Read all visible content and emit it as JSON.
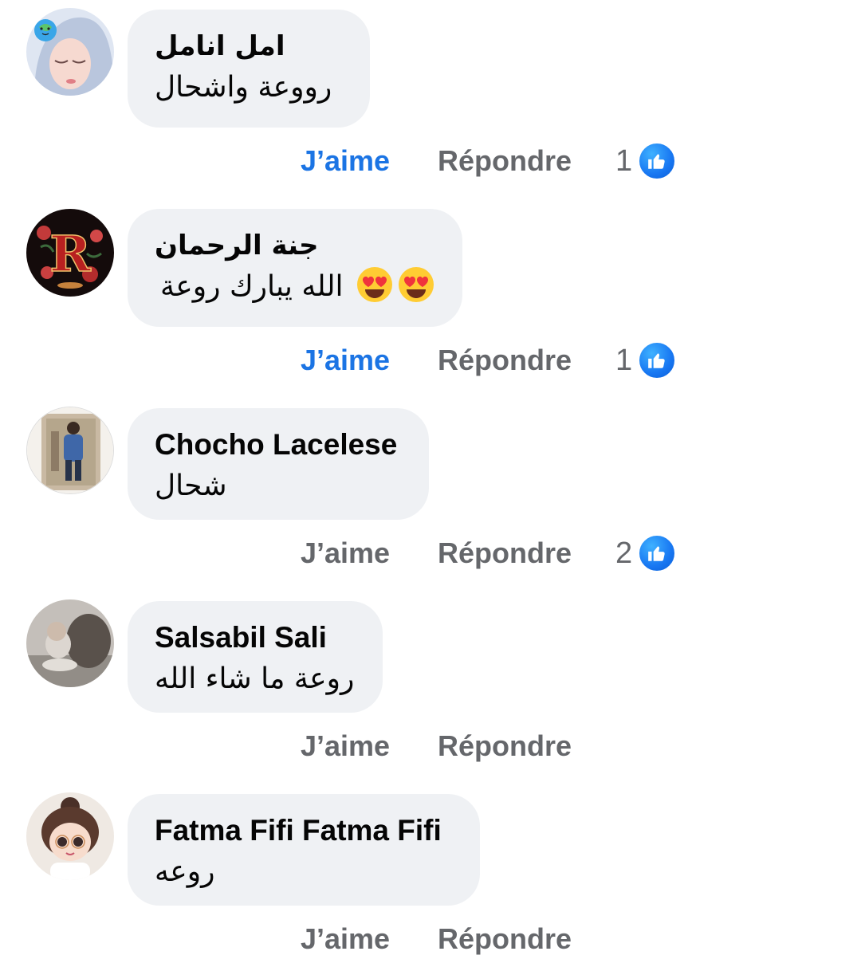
{
  "comments": [
    {
      "author": "امل انامل",
      "text": "رووعة واشحال",
      "avatar_icon": "avatar-girl-hijab",
      "like_label": "J’aime",
      "reply_label": "Répondre",
      "liked": true,
      "reaction_count": "1",
      "reaction_icon": "like-icon"
    },
    {
      "author": "جنة الرحمان",
      "text": "الله يبارك روعة",
      "emojis": [
        "heart-eyes-emoji",
        "heart-eyes-emoji"
      ],
      "avatar_icon": "avatar-letter-r-roses",
      "like_label": "J’aime",
      "reply_label": "Répondre",
      "liked": true,
      "reaction_count": "1",
      "reaction_icon": "like-icon"
    },
    {
      "author": "Chocho Lacelese",
      "text": "شحال",
      "avatar_icon": "avatar-person-photo",
      "like_label": "J’aime",
      "reply_label": "Répondre",
      "liked": false,
      "reaction_count": "2",
      "reaction_icon": "like-icon"
    },
    {
      "author": "Salsabil Sali",
      "text": "روعة ما شاء الله",
      "avatar_icon": "avatar-baby-photo",
      "like_label": "J’aime",
      "reply_label": "Répondre",
      "liked": false
    },
    {
      "author": "Fatma Fifi Fatma Fifi",
      "text": "روعه",
      "avatar_icon": "avatar-cartoon-girl",
      "like_label": "J’aime",
      "reply_label": "Répondre",
      "liked": false
    }
  ],
  "colors": {
    "bubble": "#eff1f4",
    "liked_link": "#1b74e4",
    "action_link": "#65676b",
    "like_badge": "#1877f2",
    "text": "#050505"
  }
}
